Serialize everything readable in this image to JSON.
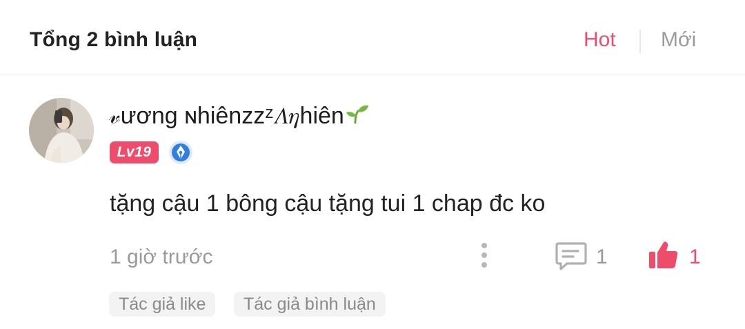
{
  "header": {
    "title": "Tổng 2 bình luận",
    "sort_hot": "Hot",
    "sort_new": "Mới"
  },
  "colors": {
    "accent": "#ef4c6b",
    "muted": "#9a9a9a",
    "badge_blue": "#2f7fe0"
  },
  "comment": {
    "username": "𝓋ương ɴhiênzzᶻ𝛬𝜂hiên",
    "level_badge": "Lv19",
    "author_badge_icon": "pen-nib-icon",
    "text": "tặng cậu 1 bông cậu tặng tui 1 chap đc ko",
    "timestamp": "1 giờ trước",
    "reply_count": "1",
    "like_count": "1",
    "tags": [
      "Tác giả like",
      "Tác giả bình luận"
    ]
  }
}
